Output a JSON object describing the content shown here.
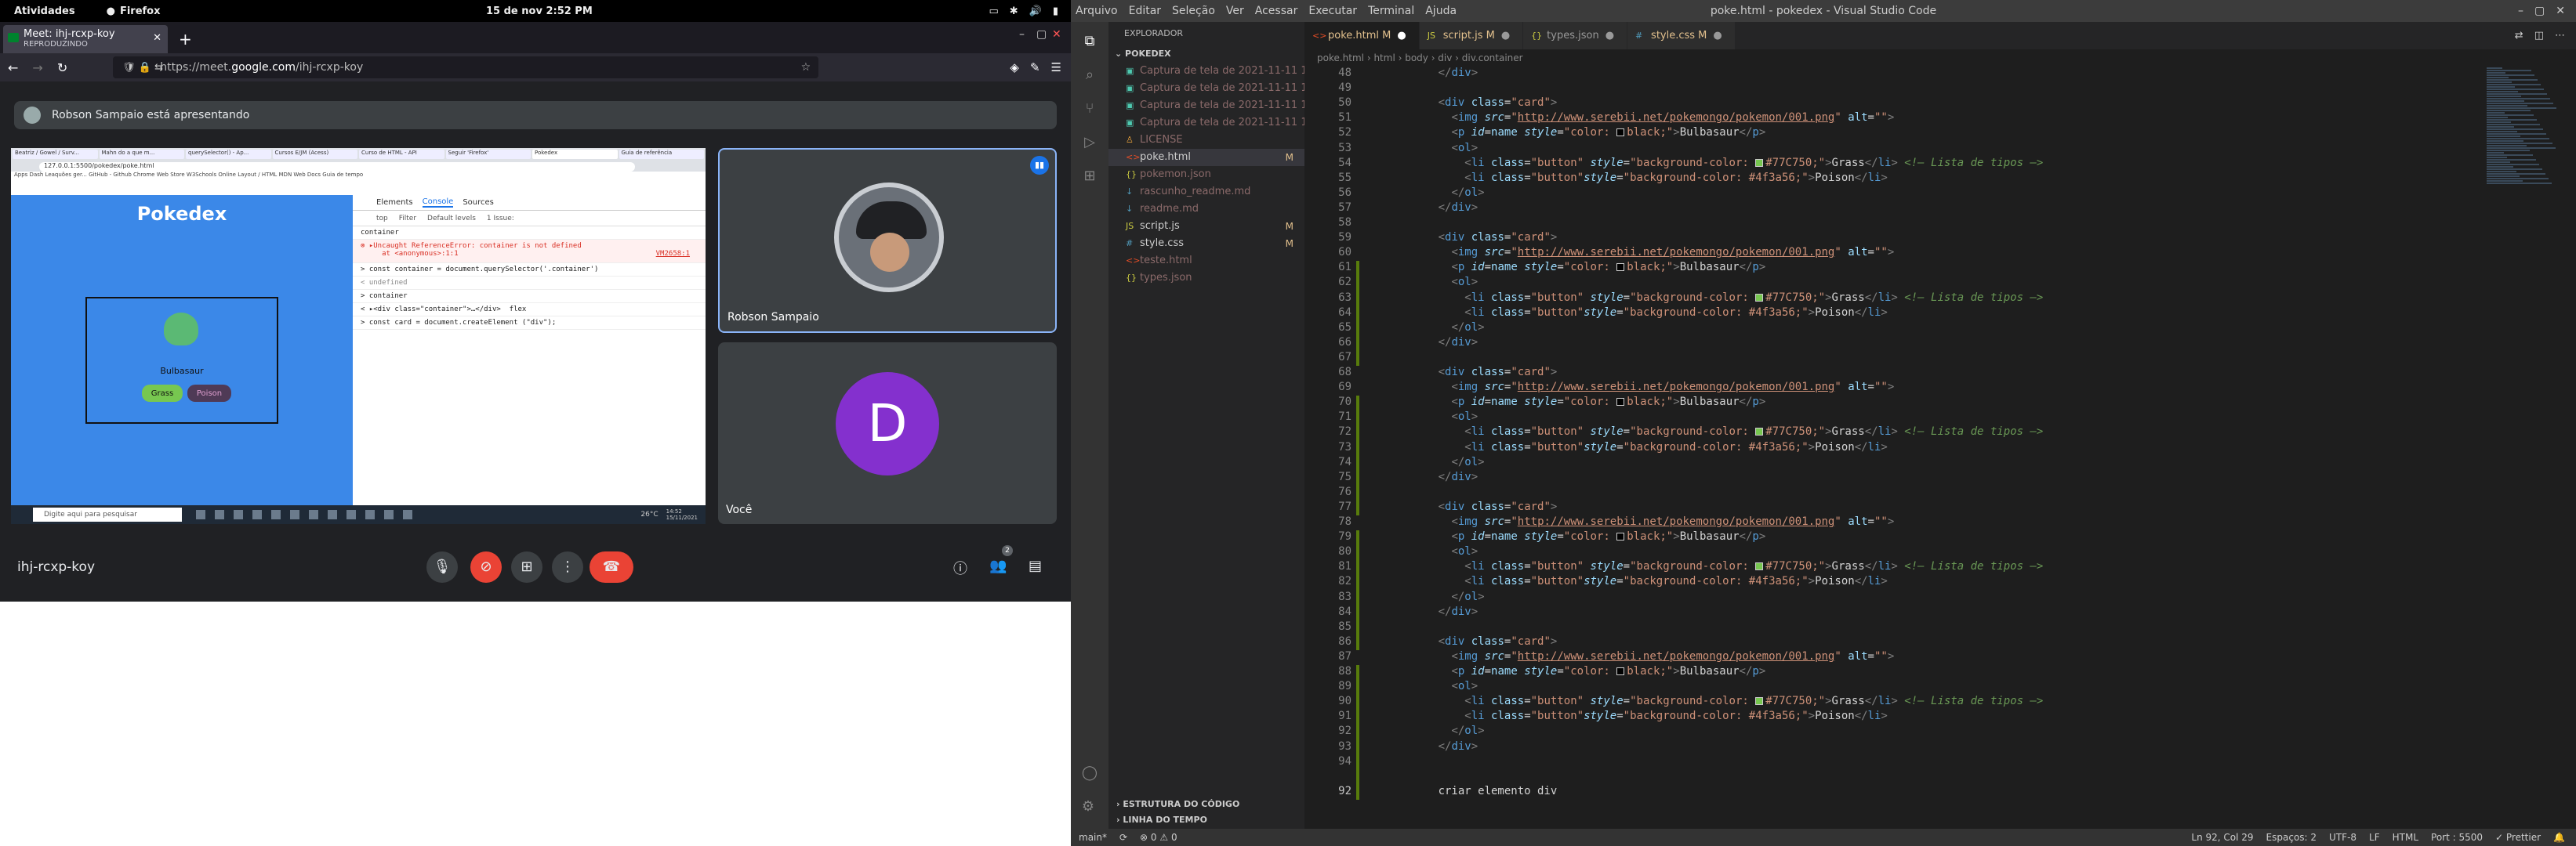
{
  "gnome": {
    "activities": "Atividades",
    "app": "Firefox",
    "clock": "15 de nov  2:52 PM"
  },
  "firefox": {
    "tab": {
      "title": "Meet: ihj-rcxp-koy",
      "subtitle": "REPRODUZINDO"
    },
    "url": {
      "prefix": "https://meet.",
      "host": "google.com",
      "path": "/ihj-rcxp-koy"
    }
  },
  "meet": {
    "presenting": "Robson Sampaio está apresentando",
    "shared": {
      "tabs": [
        "Beatriz / Gowel / Surv...",
        "Mahn do a que m...",
        "querySelector() - Ap...",
        "Cursos E/JM (Acess)",
        "Curso de HTML - API",
        "Seguir 'Firefox'",
        "Pokedex",
        "Guia de referência"
      ],
      "url": "127.0.0.1:5500/pokedex/poke.html",
      "bookmarks": "Apps   Dash Leaquões ger...   GitHub - Github   Chrome Web Store   W3Schools Online   Layout / HTML   MDN Web Docs   Guia de tempo",
      "page_title": "Pokedex",
      "card_name": "Bulbasaur",
      "card_types": [
        "Grass",
        "Poison"
      ],
      "devtools": {
        "tabs": [
          "Elements",
          "Console",
          "Sources"
        ],
        "context": "top",
        "filter_placeholder": "Filter",
        "levels": "Default levels",
        "issues": "1 Issue:",
        "lines": [
          "container",
          "⊗ ▸Uncaught ReferenceError: container is not defined\n     at <anonymous>:1:1",
          "> const container = document.querySelector('.container')",
          "< undefined",
          "> container",
          "< ▸<div class=\"container\">…</div>  flex",
          "> const card = document.createElement (\"div\");"
        ],
        "error_source": "VM2658:1"
      },
      "taskbar_search": "Digite aqui para pesquisar",
      "taskbar_temp": "26°C",
      "taskbar_clock": "14:52\n15/11/2021"
    },
    "participants": [
      {
        "name": "Robson Sampaio"
      },
      {
        "name": "Você",
        "initial": "D"
      }
    ],
    "meeting_code": "ihj-rcxp-koy",
    "people_count": "2"
  },
  "vscode": {
    "window_title": "poke.html - pokedex - Visual Studio Code",
    "menu": [
      "Arquivo",
      "Editar",
      "Seleção",
      "Ver",
      "Acessar",
      "Executar",
      "Terminal",
      "Ajuda"
    ],
    "explorer": {
      "header": "EXPLORADOR",
      "root": "POKEDEX",
      "files": [
        {
          "name": "Captura de tela de 2021-11-11 17...",
          "icon": "image-icon",
          "badge": "",
          "state": "deleted"
        },
        {
          "name": "Captura de tela de 2021-11-11 18...",
          "icon": "image-icon",
          "badge": "",
          "state": "deleted"
        },
        {
          "name": "Captura de tela de 2021-11-11 18...",
          "icon": "image-icon",
          "badge": "",
          "state": "deleted"
        },
        {
          "name": "Captura de tela de 2021-11-11 18...",
          "icon": "image-icon",
          "badge": "",
          "state": "deleted"
        },
        {
          "name": "LICENSE",
          "icon": "license-icon",
          "badge": "",
          "state": "deleted"
        },
        {
          "name": "poke.html",
          "icon": "html-icon",
          "badge": "M",
          "state": "selected"
        },
        {
          "name": "pokemon.json",
          "icon": "json-icon",
          "badge": "",
          "state": "deleted"
        },
        {
          "name": "rascunho_readme.md",
          "icon": "markdown-icon",
          "badge": "",
          "state": "deleted"
        },
        {
          "name": "readme.md",
          "icon": "markdown-icon",
          "badge": "",
          "state": "deleted"
        },
        {
          "name": "script.js",
          "icon": "js-icon",
          "badge": "M",
          "state": "normal"
        },
        {
          "name": "style.css",
          "icon": "css-icon",
          "badge": "M",
          "state": "normal"
        },
        {
          "name": "teste.html",
          "icon": "html-icon",
          "badge": "",
          "state": "deleted"
        },
        {
          "name": "types.json",
          "icon": "json-icon",
          "badge": "",
          "state": "deleted"
        }
      ],
      "outline": "ESTRUTURA DO CÓDIGO",
      "timeline": "LINHA DO TEMPO"
    },
    "tabs": [
      {
        "name": "poke.html",
        "badge": "M",
        "icon": "html-icon",
        "active": true
      },
      {
        "name": "script.js",
        "badge": "M",
        "icon": "js-icon",
        "active": false
      },
      {
        "name": "types.json",
        "badge": "",
        "icon": "json-icon",
        "active": false
      },
      {
        "name": "style.css",
        "badge": "M",
        "icon": "css-icon",
        "active": false
      }
    ],
    "breadcrumbs": "poke.html › html › body › div › div.container",
    "card_block": {
      "img_src": "http://www.serebii.net/pokemongo/pokemon/001.png",
      "p_style_color": "black",
      "name": "Bulbasaur",
      "grass_color": "#77C750",
      "poison_color": "#4f3a56",
      "grass": "Grass",
      "poison": "Poison",
      "comment": "Lista de tipos"
    },
    "last_line_number": "92",
    "last_line_text": "criar elemento div",
    "status": {
      "branch": "main*",
      "errors": "⊗ 0 ⚠ 0",
      "position": "Ln 92, Col 29",
      "spaces": "Espaços: 2",
      "encoding": "UTF-8",
      "eol": "LF",
      "language": "HTML",
      "port": "Port : 5500",
      "prettier": "✓ Prettier"
    }
  }
}
